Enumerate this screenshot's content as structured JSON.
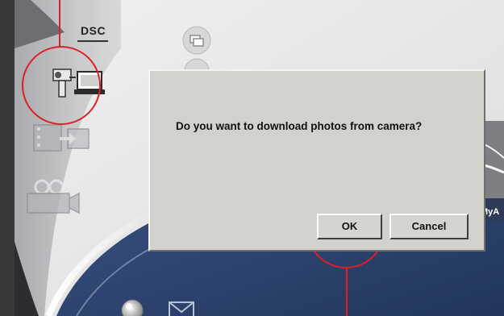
{
  "app": {
    "section_label": "DSC",
    "partial_label": "MyA"
  },
  "sidebar": {
    "items": [
      {
        "name": "download-from-camera",
        "icon": "camera-to-pc-icon"
      },
      {
        "name": "video-transfer",
        "icon": "film-to-pc-icon"
      },
      {
        "name": "video-camera",
        "icon": "video-camera-icon"
      }
    ]
  },
  "dialog": {
    "message": "Do you want to download photos from camera?",
    "ok_label": "OK",
    "cancel_label": "Cancel"
  },
  "colors": {
    "annotation": "#dd1f26",
    "dialog_bg": "#d3d1cb",
    "panel_blue": "#2d4370"
  }
}
